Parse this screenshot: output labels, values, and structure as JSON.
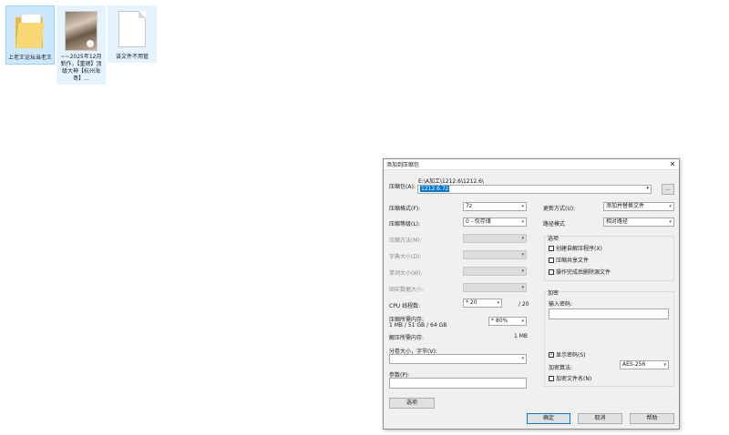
{
  "desktop": {
    "files": [
      {
        "name": "上老王论坛当老王",
        "icon": "folder-icon"
      },
      {
        "name": "~~2025年12月新作，【重磅】顶级大神【杭州海哥】...",
        "icon": "video-thumbnail-icon"
      },
      {
        "name": "该文件不用管",
        "icon": "blank-file-icon"
      }
    ]
  },
  "dialog": {
    "title": "添加到压缩包",
    "close": "✕",
    "archive": {
      "label": "压缩包(A):",
      "path": "E:\\A加工\\1212.6\\1212.6\\",
      "filename": "1212.6.7z",
      "browse_label": "..."
    },
    "format": {
      "label": "压缩格式(F):",
      "value": "7z"
    },
    "level": {
      "label": "压缩等级(L):",
      "value": "0 - 仅存储"
    },
    "method": {
      "label": "压缩方法(M):"
    },
    "dict": {
      "label": "字典大小(D):"
    },
    "word": {
      "label": "单词大小(W):"
    },
    "solid": {
      "label": "固实数据大小:"
    },
    "threads": {
      "label": "CPU 线程数:",
      "value": "* 20",
      "max": "/ 20"
    },
    "mem_compress": {
      "label": "压缩所需内存:",
      "detail": "1 MB / 51 GB / 64 GB",
      "percent": "* 80%"
    },
    "mem_decompress": {
      "label": "解压所需内存:",
      "value": "1 MB"
    },
    "split": {
      "label": "分卷大小，字节(V):"
    },
    "params": {
      "label": "参数(P):"
    },
    "options_button": "选项",
    "update": {
      "label": "更新方式(U):",
      "value": "添加并替换文件"
    },
    "path_mode": {
      "label": "路径模式",
      "value": "相对路径"
    },
    "options_group": {
      "label": "选项",
      "items": [
        {
          "label": "创建自解压程序(X)",
          "checked": false
        },
        {
          "label": "压缩共享文件",
          "checked": false
        },
        {
          "label": "操作完成后删除源文件",
          "checked": false
        }
      ]
    },
    "encrypt_group": {
      "label": "加密",
      "password_label": "输入密码:",
      "show_password": {
        "label": "显示密码(S)",
        "checked": true
      },
      "method_label": "加密算法:",
      "method_value": "AES-256",
      "encrypt_names": {
        "label": "加密文件名(N)",
        "checked": false
      }
    },
    "buttons": {
      "ok": "确定",
      "cancel": "取消",
      "help": "帮助"
    }
  }
}
